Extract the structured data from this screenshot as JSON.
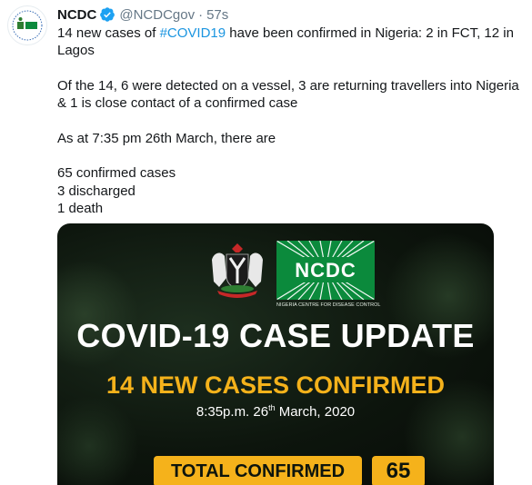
{
  "tweet": {
    "author": {
      "display_name": "NCDC",
      "handle": "@NCDCgov",
      "separator": "·",
      "time": "57s"
    },
    "text": {
      "line1_prefix": "14 new cases of ",
      "hashtag": "#COVID19",
      "line1_suffix": " have been confirmed in Nigeria: 2 in FCT, 12 in Lagos",
      "p2": "Of the 14, 6 were detected on a vessel, 3 are returning travellers into Nigeria & 1 is close contact of a confirmed case",
      "p3": "As at 7:35 pm 26th March, there are",
      "p4_l1": "65 confirmed cases",
      "p4_l2": "3 discharged",
      "p4_l3": "1 death"
    },
    "media": {
      "logo_word": "NCDC",
      "logo_tagline": "NIGERIA CENTRE FOR DISEASE CONTROL",
      "headline": "COVID-19 CASE UPDATE",
      "subhead": "14 NEW CASES CONFIRMED",
      "date_prefix": "8:35p.m. 26",
      "date_sup": "th",
      "date_suffix": " March, 2020",
      "stat_label": "TOTAL CONFIRMED",
      "stat_value": "65"
    }
  },
  "colors": {
    "hashtag": "#1b95e0",
    "verified": "#1da1f2",
    "accent_yellow": "#f5b21b",
    "logo_green": "#0b8a3c",
    "card_dark": "#0d150d"
  },
  "icons": {
    "verified": "verified-badge-icon",
    "avatar": "ncdc-avatar"
  }
}
